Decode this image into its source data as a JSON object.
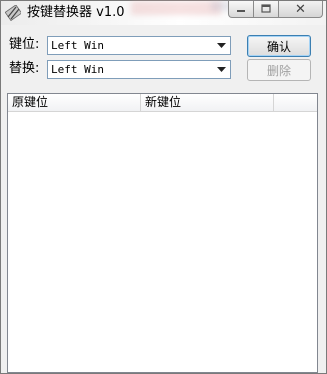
{
  "window": {
    "title": "按键替换器 v1.0",
    "icon": "pencil-icon",
    "caption": {
      "minimize": "minimize-icon",
      "maximize": "maximize-icon",
      "close_glyph": "✕"
    }
  },
  "form": {
    "key_label": "键位:",
    "key_value": "Left Win",
    "replace_label": "替换:",
    "replace_value": "Left Win",
    "confirm_label": "确认",
    "delete_label": "删除"
  },
  "list": {
    "columns": [
      "原键位",
      "新键位",
      ""
    ]
  },
  "colors": {
    "accent_border": "#3c7fb1",
    "disabled_text": "#a0a0a0"
  }
}
